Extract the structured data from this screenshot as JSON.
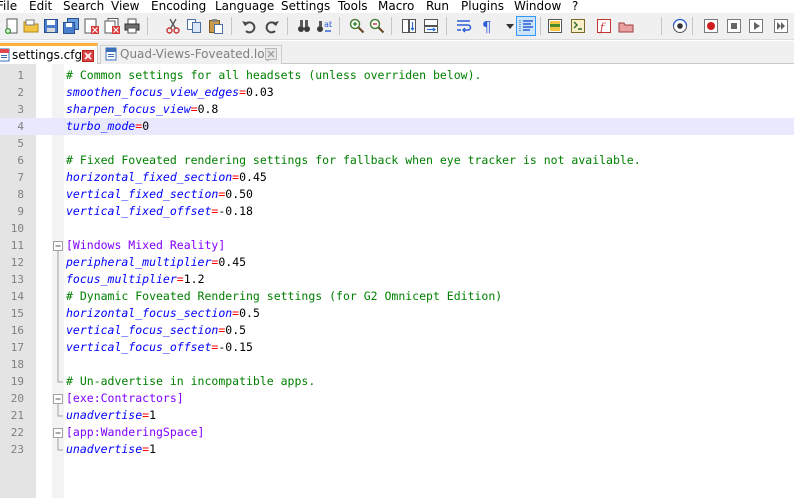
{
  "menu": [
    "File",
    "Edit",
    "Search",
    "View",
    "Encoding",
    "Language",
    "Settings",
    "Tools",
    "Macro",
    "Run",
    "Plugins",
    "Window",
    "?"
  ],
  "toolbar": {
    "icons": [
      "new-file-icon",
      "open-file-icon",
      "save-icon",
      "save-all-icon",
      "close-icon",
      "close-all-icon",
      "print-icon",
      "cut-icon",
      "copy-icon",
      "paste-icon",
      "undo-icon",
      "redo-icon",
      "find-icon",
      "replace-icon",
      "zoom-in-icon",
      "zoom-out-icon",
      "sync-vertical-icon",
      "sync-horizontal-icon",
      "word-wrap-icon",
      "show-all-chars-icon",
      "indent-guide-icon",
      "doc-map-icon",
      "function-list-icon",
      "folder-workspace-icon",
      "monitoring-icon",
      "record-macro-icon",
      "stop-macro-icon",
      "play-macro-icon",
      "run-macro-multiple-icon",
      "save-macro-icon"
    ],
    "active": "indent-guide-icon"
  },
  "tabs": [
    {
      "label": "settings.cfg",
      "active": true,
      "state": "unsaved"
    },
    {
      "label": "Quad-Views-Foveated.log",
      "active": false,
      "state": "saved"
    }
  ],
  "editor": {
    "current_line": 4,
    "lines": [
      {
        "n": "1",
        "type": "comment",
        "text": "# Common settings for all headsets (unless overriden below)."
      },
      {
        "n": "2",
        "type": "kv",
        "key": "smoothen_focus_view_edges",
        "op": "=",
        "val": "0.03"
      },
      {
        "n": "3",
        "type": "kv",
        "key": "sharpen_focus_view",
        "op": "=",
        "val": "0.8"
      },
      {
        "n": "4",
        "type": "kv",
        "key": "turbo_mode",
        "op": "=",
        "val": "0"
      },
      {
        "n": "5",
        "type": "empty"
      },
      {
        "n": "6",
        "type": "comment",
        "text": "# Fixed Foveated rendering settings for fallback when eye tracker is not available."
      },
      {
        "n": "7",
        "type": "kv",
        "key": "horizontal_fixed_section",
        "op": "=",
        "val": "0.45"
      },
      {
        "n": "8",
        "type": "kv",
        "key": "vertical_fixed_section",
        "op": "=",
        "val": "0.50"
      },
      {
        "n": "9",
        "type": "kv",
        "key": "vertical_fixed_offset",
        "op": "=",
        "val": "-0.18"
      },
      {
        "n": "10",
        "type": "empty"
      },
      {
        "n": "11",
        "type": "section",
        "text": "[Windows Mixed Reality]",
        "fold": "start"
      },
      {
        "n": "12",
        "type": "kv",
        "key": "peripheral_multiplier",
        "op": "=",
        "val": "0.45",
        "fold": "line"
      },
      {
        "n": "13",
        "type": "kv",
        "key": "focus_multiplier",
        "op": "=",
        "val": "1.2",
        "fold": "line"
      },
      {
        "n": "14",
        "type": "comment",
        "text": "# Dynamic Foveated Rendering settings (for G2 Omnicept Edition)",
        "fold": "line"
      },
      {
        "n": "15",
        "type": "kv",
        "key": "horizontal_focus_section",
        "op": "=",
        "val": "0.5",
        "fold": "line"
      },
      {
        "n": "16",
        "type": "kv",
        "key": "vertical_focus_section",
        "op": "=",
        "val": "0.5",
        "fold": "line"
      },
      {
        "n": "17",
        "type": "kv",
        "key": "vertical_focus_offset",
        "op": "=",
        "val": "-0.15",
        "fold": "line"
      },
      {
        "n": "18",
        "type": "empty",
        "fold": "line"
      },
      {
        "n": "19",
        "type": "comment",
        "text": "# Un-advertise in incompatible apps.",
        "fold": "end"
      },
      {
        "n": "20",
        "type": "section",
        "text": "[exe:Contractors]",
        "fold": "start"
      },
      {
        "n": "21",
        "type": "kv",
        "key": "unadvertise",
        "op": "=",
        "val": "1",
        "fold": "end"
      },
      {
        "n": "22",
        "type": "section",
        "text": "[app:WanderingSpace]",
        "fold": "start"
      },
      {
        "n": "23",
        "type": "kv",
        "key": "unadvertise",
        "op": "=",
        "val": "1",
        "fold": "end"
      }
    ]
  },
  "colors": {
    "comment": "#008000",
    "key": "#0000ff",
    "operator": "#ff0000",
    "section": "#8000ff",
    "current_line_bg": "#e8e8ff",
    "active_tab_accent": "#ffb03b"
  }
}
